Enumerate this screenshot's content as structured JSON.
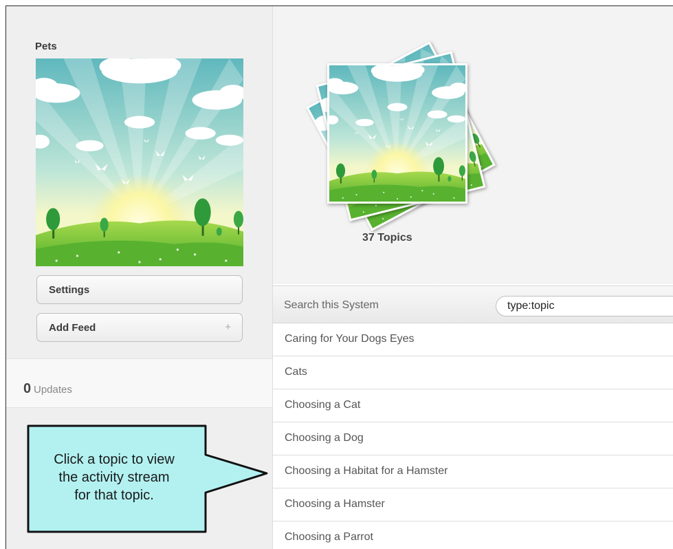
{
  "sidebar": {
    "title": "Pets",
    "settings_label": "Settings",
    "add_feed_label": "Add Feed",
    "add_feed_symbol": "+",
    "updates_count": "0",
    "updates_label": "Updates"
  },
  "banner": {
    "topics_count": "37 Topics"
  },
  "search": {
    "label": "Search this System",
    "value": "type:topic"
  },
  "topics": [
    "Caring for Your Dogs Eyes",
    "Cats",
    "Choosing a Cat",
    "Choosing a Dog",
    "Choosing a Habitat for a Hamster",
    "Choosing a Hamster",
    "Choosing a Parrot"
  ],
  "callout": {
    "lines": [
      "Click a topic to view",
      "the activity stream",
      "for that topic."
    ]
  },
  "colors": {
    "callout_fill": "#b3f1f1",
    "sky": "#7cc9c7",
    "grass": "#7ec83c"
  }
}
